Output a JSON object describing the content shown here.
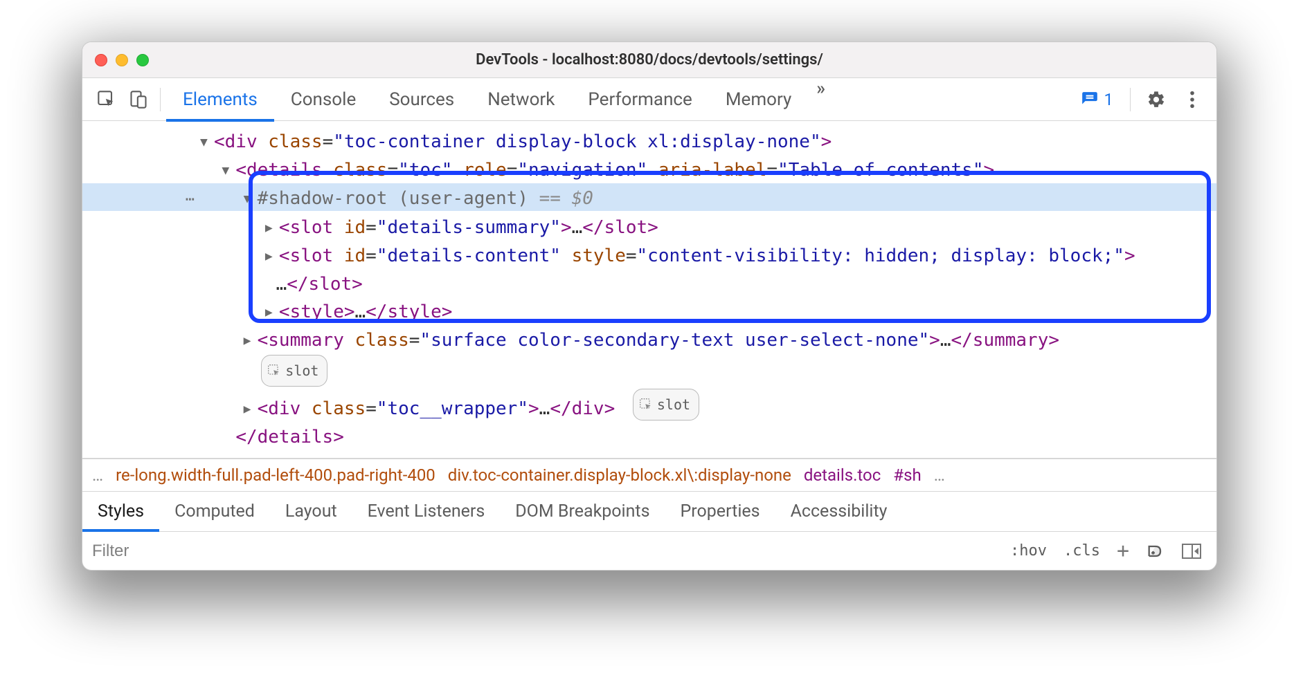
{
  "window": {
    "title": "DevTools - localhost:8080/docs/devtools/settings/"
  },
  "tabs": {
    "items": [
      "Elements",
      "Console",
      "Sources",
      "Network",
      "Performance",
      "Memory"
    ],
    "active_index": 0,
    "more_glyph": "»"
  },
  "issues": {
    "count_label": "1"
  },
  "tree": {
    "gutter_ellipsis": "⋯",
    "l1": {
      "tag_open": "<div",
      "class_name": "class",
      "class_val": "\"toc-container display-block xl:display-none\"",
      "gt": ">"
    },
    "l2": {
      "tag_open": "<details",
      "class_name": "class",
      "class_val": "\"toc\"",
      "role_name": "role",
      "role_val": "\"navigation\"",
      "aria_name": "aria-label",
      "aria_val": "\"Table of contents\"",
      "gt": ">"
    },
    "shadow": {
      "label": "#shadow-root (user-agent)",
      "eqzero": " == $0"
    },
    "slot1": {
      "open": "<slot",
      "id_name": "id",
      "id_val": "\"details-summary\"",
      "gt": ">",
      "ell": "…",
      "close": "</slot>"
    },
    "slot2": {
      "open": "<slot",
      "id_name": "id",
      "id_val": "\"details-content\"",
      "style_name": "style",
      "style_val": "\"content-visibility: hidden; display: block;\"",
      "gt": ">",
      "ell": "…",
      "close": "</slot>"
    },
    "styleline": {
      "open": "<style>",
      "ell": "…",
      "close": "</style>"
    },
    "summary": {
      "open": "<summary",
      "class_name": "class",
      "class_val": "\"surface color-secondary-text user-select-none\"",
      "gt": ">",
      "ell": "…",
      "close": "</summary>"
    },
    "slot_badge": "slot",
    "wrapper": {
      "open": "<div",
      "class_name": "class",
      "class_val": "\"toc__wrapper\"",
      "gt": ">",
      "ell": "…",
      "close": "</div>"
    },
    "close_details": "</details>"
  },
  "crumbs": {
    "left_ell": "…",
    "c1": "re-long.width-full.pad-left-400.pad-right-400",
    "c2": "div.toc-container.display-block.xl\\:display-none",
    "c3": "details.toc",
    "c4": "#sh",
    "right_ell": "…"
  },
  "subtabs": {
    "items": [
      "Styles",
      "Computed",
      "Layout",
      "Event Listeners",
      "DOM Breakpoints",
      "Properties",
      "Accessibility"
    ],
    "active_index": 0
  },
  "filterbar": {
    "placeholder": "Filter",
    "hov": ":hov",
    "cls": ".cls"
  }
}
